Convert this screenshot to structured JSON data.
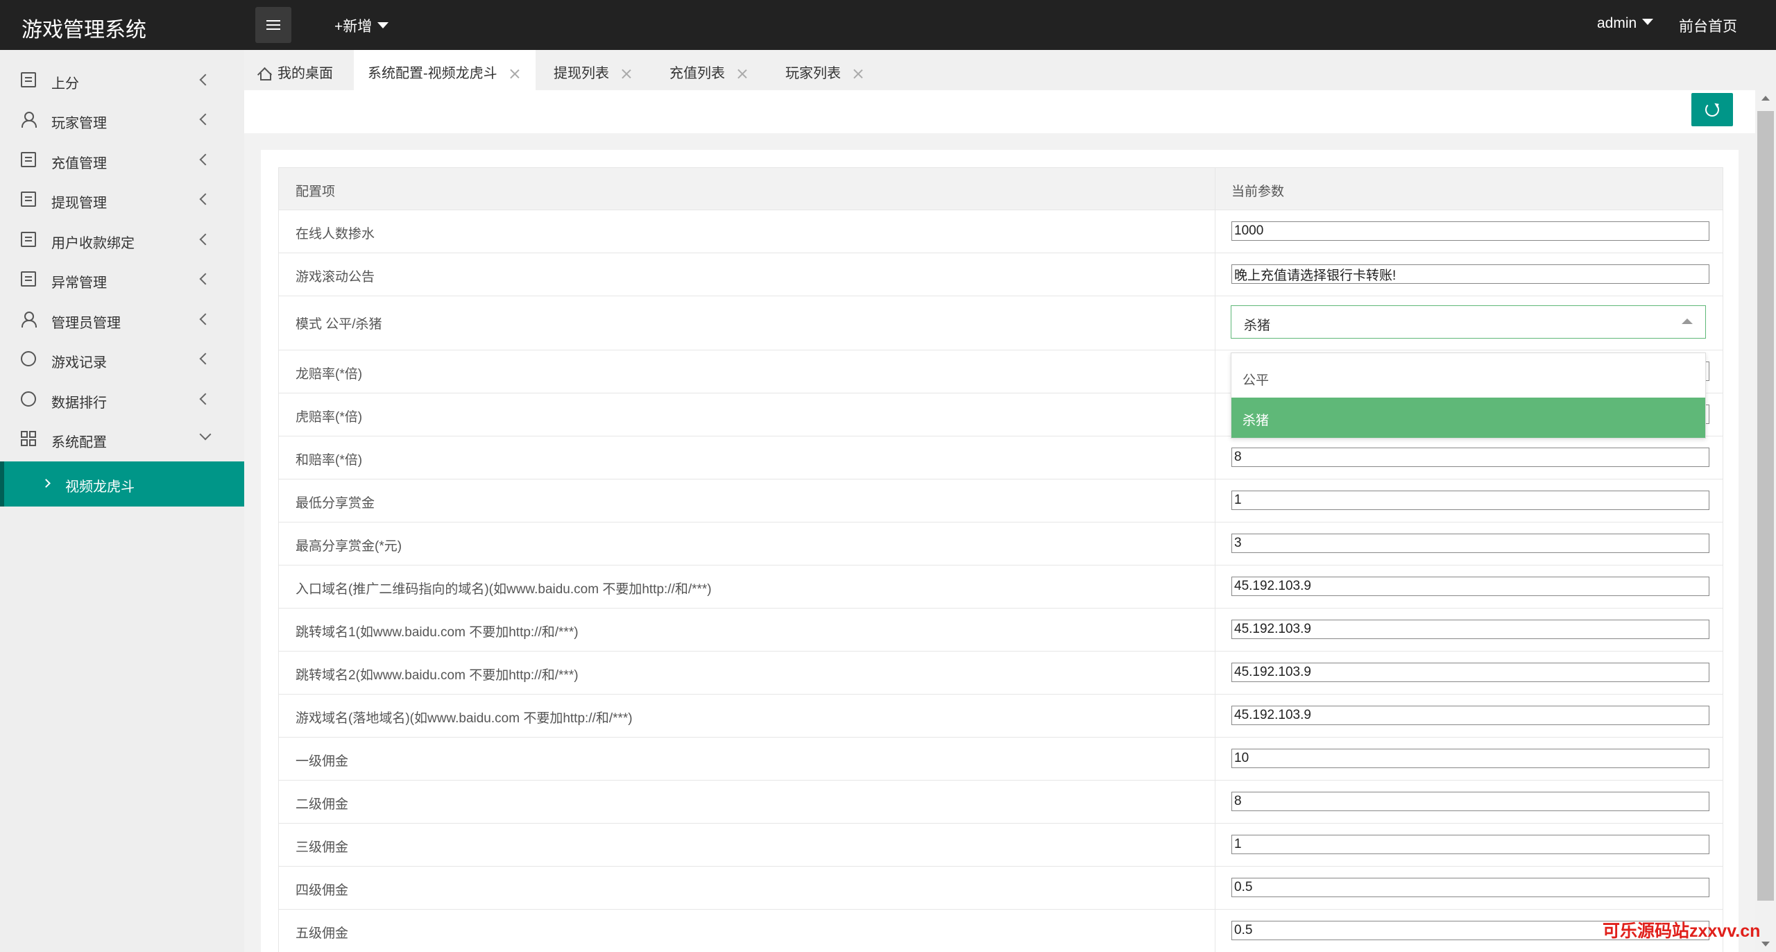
{
  "app": {
    "title": "游戏管理系统",
    "add_new": "+新增",
    "user": "admin",
    "home_link": "前台首页"
  },
  "sidebar": {
    "items": [
      {
        "label": "上分",
        "icon": "doc-icon"
      },
      {
        "label": "玩家管理",
        "icon": "user-icon"
      },
      {
        "label": "充值管理",
        "icon": "doc-icon"
      },
      {
        "label": "提现管理",
        "icon": "doc-icon"
      },
      {
        "label": "用户收款绑定",
        "icon": "doc-icon"
      },
      {
        "label": "异常管理",
        "icon": "doc-icon"
      },
      {
        "label": "管理员管理",
        "icon": "admin-user-icon"
      },
      {
        "label": "游戏记录",
        "icon": "cloud-icon"
      },
      {
        "label": "数据排行",
        "icon": "cloud-icon"
      },
      {
        "label": "系统配置",
        "icon": "grid-icon"
      }
    ],
    "active_sub_item": "视频龙虎斗"
  },
  "tabs": [
    {
      "label": "我的桌面"
    },
    {
      "label": "系统配置-视频龙虎斗"
    },
    {
      "label": "提现列表"
    },
    {
      "label": "充值列表"
    },
    {
      "label": "玩家列表"
    }
  ],
  "table": {
    "headers": [
      "配置项",
      "当前参数"
    ],
    "rows": [
      {
        "label": "在线人数掺水",
        "value": "1000"
      },
      {
        "label": "游戏滚动公告",
        "value": "晚上充值请选择银行卡转账!"
      },
      {
        "label": "模式 公平/杀猪",
        "value": "杀猪"
      },
      {
        "label": "龙赔率(*倍)",
        "value": ""
      },
      {
        "label": "虎赔率(*倍)",
        "value": ""
      },
      {
        "label": "和赔率(*倍)",
        "value": "8"
      },
      {
        "label": "最低分享赏金",
        "value": "1"
      },
      {
        "label": "最高分享赏金(*元)",
        "value": "3"
      },
      {
        "label": "入口域名(推广二维码指向的域名)(如www.baidu.com 不要加http://和/***)",
        "value": "45.192.103.9"
      },
      {
        "label": "跳转域名1(如www.baidu.com 不要加http://和/***)",
        "value": "45.192.103.9"
      },
      {
        "label": "跳转域名2(如www.baidu.com 不要加http://和/***)",
        "value": "45.192.103.9"
      },
      {
        "label": "游戏域名(落地域名)(如www.baidu.com 不要加http://和/***)",
        "value": "45.192.103.9"
      },
      {
        "label": "一级佣金",
        "value": "10"
      },
      {
        "label": "二级佣金",
        "value": "8"
      },
      {
        "label": "三级佣金",
        "value": "1"
      },
      {
        "label": "四级佣金",
        "value": "0.5"
      },
      {
        "label": "五级佣金",
        "value": "0.5"
      }
    ]
  },
  "mode_dropdown": {
    "options": [
      "公平",
      "杀猪"
    ],
    "selected": "杀猪"
  },
  "watermark": "可乐源码站zxxvv.cn",
  "colors": {
    "accent": "#009688",
    "selected_option": "#5fb878",
    "topbar": "#222222"
  }
}
